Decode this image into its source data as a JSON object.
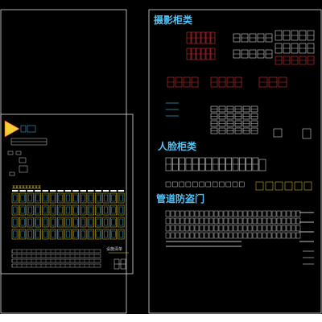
{
  "drawing": {
    "section_titles": [
      "摄影柜类",
      "人脸柜类",
      "管道防盗门"
    ],
    "small_title": "设施清单",
    "chinese_note": "某某某某某某某某某"
  },
  "colors": {
    "background": "#000000",
    "frame": "#e8e8e8",
    "cyan": "#4fc3f7",
    "red": "#ff3b3b",
    "yellow": "#f2d230",
    "green": "#36e26a",
    "white": "#ffffff",
    "status_strip": "#ffffff"
  }
}
